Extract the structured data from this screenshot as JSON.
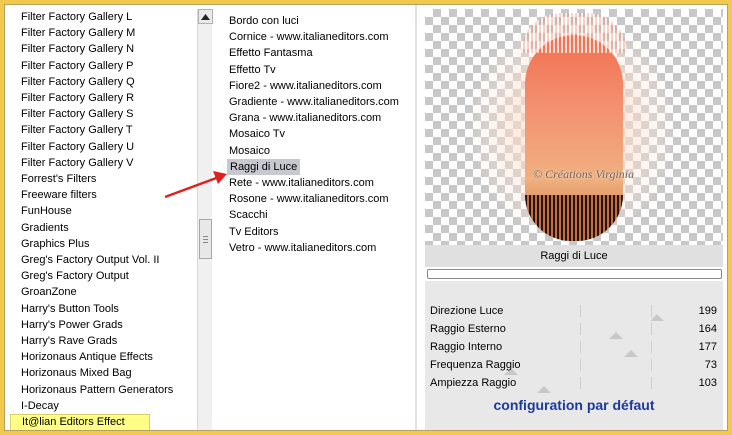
{
  "category_list": {
    "items": [
      "Filter Factory Gallery L",
      "Filter Factory Gallery M",
      "Filter Factory Gallery N",
      "Filter Factory Gallery P",
      "Filter Factory Gallery Q",
      "Filter Factory Gallery R",
      "Filter Factory Gallery S",
      "Filter Factory Gallery T",
      "Filter Factory Gallery U",
      "Filter Factory Gallery V",
      "Forrest's Filters",
      "Freeware filters",
      "FunHouse",
      "Gradients",
      "Graphics Plus",
      "Greg's Factory Output Vol. II",
      "Greg's Factory Output",
      "GroanZone",
      "Harry's Button Tools",
      "Harry's Power Grads",
      "Harry's Rave Grads",
      "Horizonaus Antique Effects",
      "Horizonaus Mixed Bag",
      "Horizonaus Pattern Generators",
      "I-Decay",
      "It@lian Editors Effect"
    ],
    "selected": "It@lian Editors Effect"
  },
  "filter_list": {
    "items": [
      "Bordo con luci",
      "Cornice - www.italianeditors.com",
      "Effetto Fantasma",
      "Effetto Tv",
      "Fiore2 - www.italianeditors.com",
      "Gradiente - www.italianeditors.com",
      "Grana - www.italianeditors.com",
      "Mosaico Tv",
      "Mosaico",
      "Raggi di Luce",
      "Rete - www.italianeditors.com",
      "Rosone - www.italianeditors.com",
      "Scacchi",
      "Tv Editors",
      "Vetro - www.italianeditors.com"
    ],
    "selected": "Raggi di Luce"
  },
  "preview": {
    "watermark": "© Créations Virginia"
  },
  "effect_name": "Raggi di Luce",
  "progress": 0,
  "sliders": [
    {
      "label": "Direzione Luce",
      "value": 199,
      "fraction": 0.78
    },
    {
      "label": "Raggio Esterno",
      "value": 164,
      "fraction": 0.64
    },
    {
      "label": "Raggio Interno",
      "value": 177,
      "fraction": 0.69
    },
    {
      "label": "Frequenza Raggio",
      "value": 73,
      "fraction": 0.29
    },
    {
      "label": "Ampiezza Raggio",
      "value": 103,
      "fraction": 0.4
    }
  ],
  "default_label": "configuration par défaut",
  "colors": {
    "outer_border": "#f2c94c",
    "selected_category_bg": "#ffff88",
    "selected_filter_bg": "#c8c8d0",
    "default_text": "#1c3a9a",
    "arrow": "#e02020"
  },
  "icons": {
    "scroll_up": "triangle-up",
    "annotation_arrow": "red-arrow"
  }
}
